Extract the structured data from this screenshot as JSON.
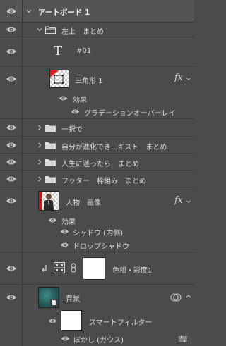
{
  "layers": {
    "artboard": "アートボード 1",
    "group_top": "左上　まとめ",
    "text_layer": "#01",
    "text_glyph": "T",
    "shape": "三角形 1",
    "effects": "効果",
    "gradient_overlay": "グラデーションオーバーレイ",
    "group_a": "一択で",
    "group_b": "自分が進化でき...キスト　まとめ",
    "group_c": "人生に迷ったら　まとめ",
    "group_d": "フッター　枠組み　まとめ",
    "person": "人物　画像",
    "effects2": "効果",
    "inner_shadow": "シャドウ (内側)",
    "drop_shadow": "ドロップシャドウ",
    "hue_sat": "色相・彩度1",
    "background": "背景",
    "smart_filter": "スマートフィルター",
    "blur": "ぼかし (ガウス)"
  },
  "fx_label": "fx",
  "icons": [
    "eye-icon",
    "chevron-down-icon",
    "chevron-right-icon",
    "folder-icon",
    "fx-icon",
    "link-icon",
    "adjustment-icon",
    "clipping-arrow-icon",
    "filter-options-icon",
    "smart-object-icon"
  ]
}
